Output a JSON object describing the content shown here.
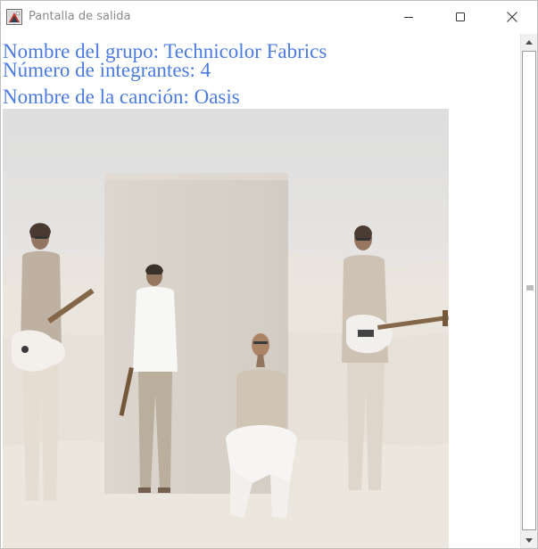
{
  "window": {
    "title": "Pantalla de salida",
    "icon": "java-app-icon",
    "controls": {
      "minimize_icon": "minimize-icon",
      "maximize_icon": "maximize-icon",
      "close_icon": "close-icon"
    }
  },
  "content": {
    "group_line": "Nombre del grupo: Technicolor Fabrics",
    "members_line": "Número de integrantes: 4",
    "song_line": "Nombre de la canción: Oasis"
  },
  "colors": {
    "text_accent": "#4b7be0",
    "title_text": "#8a8a8a",
    "scrollbar_track": "#f0f0f0"
  },
  "scrollbar": {
    "up_icon": "scroll-up-arrow-icon",
    "down_icon": "scroll-down-arrow-icon",
    "position": 0.0
  }
}
